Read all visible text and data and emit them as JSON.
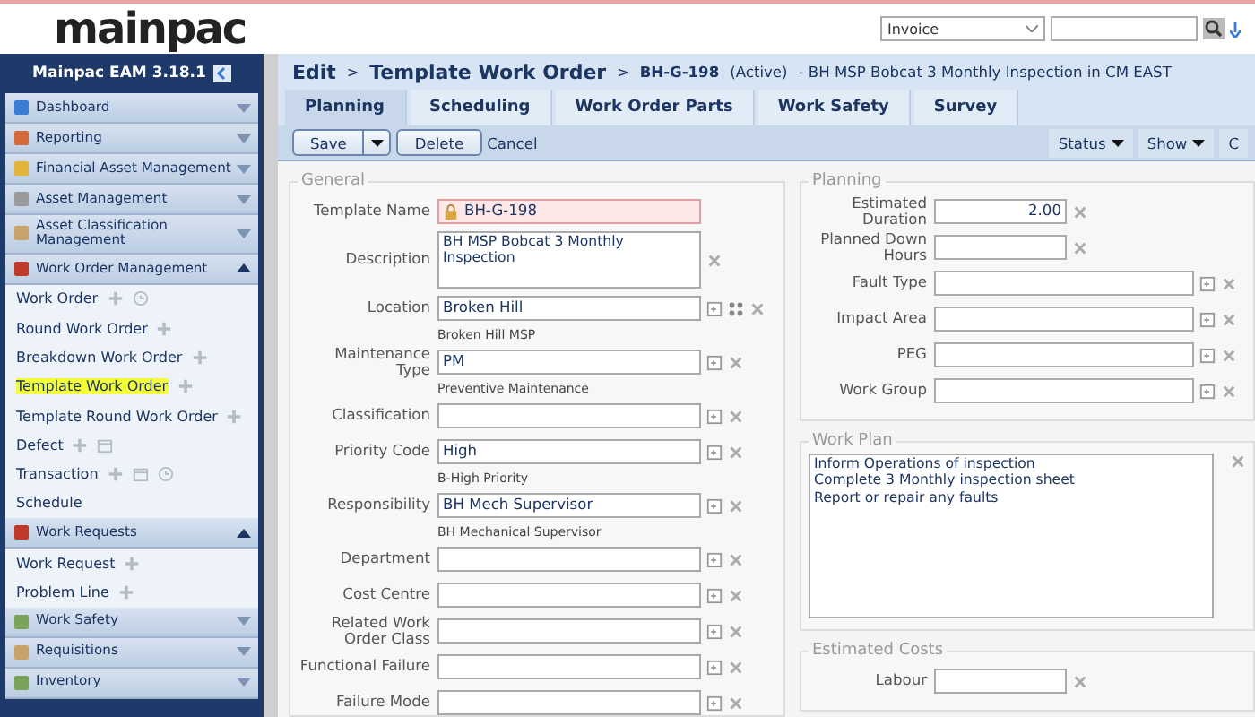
{
  "header": {
    "logo": "mainpac",
    "module_select": "Invoice"
  },
  "sidebar": {
    "title": "Mainpac EAM 3.18.1",
    "sections": [
      {
        "label": "Dashboard",
        "expanded": false
      },
      {
        "label": "Reporting",
        "expanded": false
      },
      {
        "label": "Financial Asset Management",
        "expanded": false
      },
      {
        "label": "Asset Management",
        "expanded": false
      },
      {
        "label": "Asset Classification Management",
        "expanded": false
      },
      {
        "label": "Work Order Management",
        "expanded": true,
        "children": [
          {
            "label": "Work Order",
            "selected": false,
            "add": true,
            "calendar": false,
            "clock": true
          },
          {
            "label": "Round Work Order",
            "selected": false,
            "add": true,
            "calendar": false,
            "clock": false
          },
          {
            "label": "Breakdown Work Order",
            "selected": false,
            "add": true,
            "calendar": false,
            "clock": false
          },
          {
            "label": "Template Work Order",
            "selected": true,
            "add": true,
            "calendar": false,
            "clock": false
          },
          {
            "label": "Template Round Work Order",
            "selected": false,
            "add": true,
            "calendar": false,
            "clock": false
          },
          {
            "label": "Defect",
            "selected": false,
            "add": true,
            "calendar": true,
            "clock": false
          },
          {
            "label": "Transaction",
            "selected": false,
            "add": true,
            "calendar": true,
            "clock": true
          },
          {
            "label": "Schedule",
            "selected": false,
            "add": false,
            "calendar": false,
            "clock": false
          }
        ]
      },
      {
        "label": "Work Requests",
        "expanded": true,
        "children": [
          {
            "label": "Work Request",
            "selected": false,
            "add": true,
            "calendar": false,
            "clock": false
          },
          {
            "label": "Problem Line",
            "selected": false,
            "add": true,
            "calendar": false,
            "clock": false
          }
        ]
      },
      {
        "label": "Work Safety",
        "expanded": false
      },
      {
        "label": "Requisitions",
        "expanded": false
      },
      {
        "label": "Inventory",
        "expanded": false
      }
    ]
  },
  "breadcrumb": {
    "section": "Edit",
    "separators": [
      ">",
      ">"
    ],
    "page": "Template Work Order",
    "record_id": "BH-G-198",
    "status": "(Active)",
    "description": "- BH MSP Bobcat 3 Monthly Inspection in CM EAST"
  },
  "tabs": [
    {
      "label": "Planning",
      "selected": true
    },
    {
      "label": "Scheduling",
      "selected": false
    },
    {
      "label": "Work Order Parts",
      "selected": false
    },
    {
      "label": "Work Safety",
      "selected": false
    },
    {
      "label": "Survey",
      "selected": false
    }
  ],
  "toolbar": {
    "save": "Save",
    "delete": "Delete",
    "cancel": "Cancel",
    "menus": [
      "Status",
      "Show",
      "C"
    ]
  },
  "general": {
    "title": "General",
    "fields": [
      {
        "label": "Template Name",
        "kind": "text",
        "value": "BH-G-198",
        "highlighted": true,
        "locked": true
      },
      {
        "label": "Description",
        "kind": "textarea",
        "value": "BH MSP Bobcat 3 Monthly Inspection",
        "highlighted": false,
        "clear": true
      },
      {
        "label": "Location",
        "kind": "text",
        "value": "Broken Hill",
        "hint": "Broken Hill MSP",
        "highlighted": false,
        "lookup": true,
        "locate": true,
        "clear": true
      },
      {
        "label": "Maintenance Type",
        "kind": "text",
        "value": "PM",
        "hint": "Preventive Maintenance",
        "highlighted": false,
        "lookup": true,
        "clear": true
      },
      {
        "label": "Classification",
        "kind": "text",
        "highlighted": false,
        "lookup": true,
        "clear": true
      },
      {
        "label": "Priority Code",
        "kind": "text",
        "value": "High",
        "hint": "B-High Priority",
        "highlighted": false,
        "lookup": true,
        "clear": true
      },
      {
        "label": "Responsibility",
        "kind": "text",
        "value": "BH Mech Supervisor",
        "hint": "BH Mechanical Supervisor",
        "highlighted": false,
        "lookup": true,
        "clear": true
      },
      {
        "label": "Department",
        "kind": "text",
        "highlighted": false,
        "lookup": true,
        "clear": true
      },
      {
        "label": "Cost Centre",
        "kind": "text",
        "highlighted": false,
        "lookup": true,
        "clear": true
      },
      {
        "label": "Related Work Order Class",
        "kind": "text",
        "highlighted": false,
        "lookup": true,
        "clear": true
      },
      {
        "label": "Functional Failure",
        "kind": "text",
        "highlighted": false,
        "lookup": true,
        "clear": true
      },
      {
        "label": "Failure Mode",
        "kind": "text",
        "highlighted": false,
        "lookup": true,
        "clear": true
      }
    ]
  },
  "planning": {
    "title": "Planning",
    "fields": [
      {
        "label": "Estimated Duration",
        "kind": "number",
        "value": "2.00",
        "clear": true
      },
      {
        "label": "Planned Down Hours",
        "kind": "number",
        "clear": true
      },
      {
        "label": "Fault Type",
        "kind": "text",
        "lookup": true,
        "clear": true
      },
      {
        "label": "Impact Area",
        "kind": "text",
        "lookup": true,
        "clear": true
      },
      {
        "label": "PEG",
        "kind": "text",
        "lookup": true,
        "clear": true
      },
      {
        "label": "Work Group",
        "kind": "text",
        "lookup": true,
        "clear": true
      }
    ]
  },
  "work_plan": {
    "title": "Work Plan",
    "value": "Inform Operations of inspection\nComplete 3 Monthly inspection sheet\nReport or repair any faults"
  },
  "estimated_costs": {
    "title": "Estimated Costs",
    "fields": [
      {
        "label": "Labour",
        "kind": "number",
        "clear": true
      }
    ]
  }
}
